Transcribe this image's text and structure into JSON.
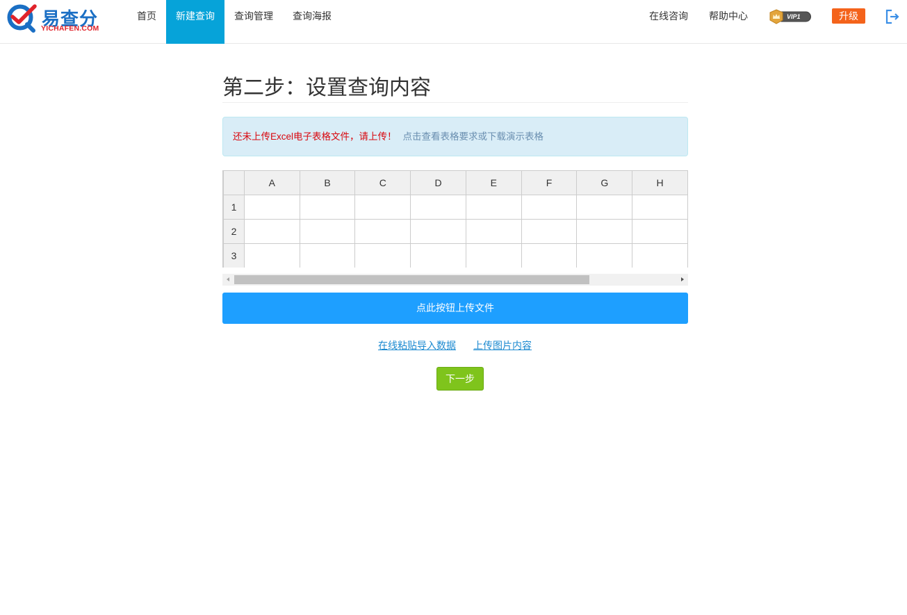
{
  "brand": {
    "name": "易查分",
    "subtitle": "YICHAFEN.COM",
    "primary_color": "#1b6fc4",
    "accent_color": "#e0232b"
  },
  "nav": {
    "items": [
      {
        "label": "首页",
        "active": false
      },
      {
        "label": "新建查询",
        "active": true
      },
      {
        "label": "查询管理",
        "active": false
      },
      {
        "label": "查询海报",
        "active": false
      }
    ],
    "active_color": "#06a3d9"
  },
  "header_right": {
    "consult": "在线咨询",
    "help": "帮助中心",
    "vip_label": "VIP1",
    "upgrade": "升级",
    "upgrade_color": "#f4631b",
    "logout_icon": "logout-icon"
  },
  "main": {
    "title": "第二步：设置查询内容",
    "alert": {
      "warning": "还未上传Excel电子表格文件，请上传！",
      "link": "点击查看表格要求或下载演示表格"
    },
    "sheet": {
      "columns": [
        "A",
        "B",
        "C",
        "D",
        "E",
        "F",
        "G",
        "H"
      ],
      "rows": [
        "1",
        "2",
        "3"
      ]
    },
    "upload_button": "点此按钮上传文件",
    "paste_link": "在线粘贴导入数据",
    "image_link": "上传图片内容",
    "next_button": "下一步"
  }
}
